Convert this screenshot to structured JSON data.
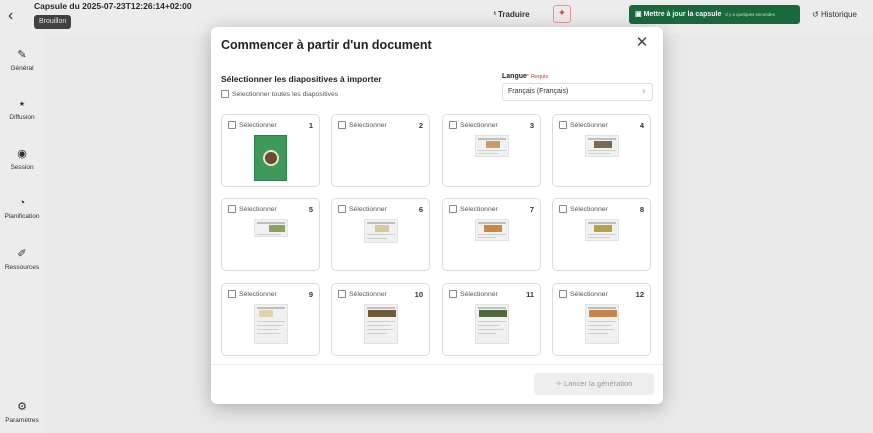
{
  "header": {
    "back_icon": "chevron-left-icon",
    "capsule_title": "Capsule du 2025-07-23T12:26:14+02:00",
    "status_badge": "Brouillon",
    "translate_label": "Traduire",
    "update_label": "Mettre à jour la capsule",
    "update_sub": "Il y a quelques secondes",
    "history_label": "Historique"
  },
  "sidebar": {
    "items": [
      {
        "label": "Général",
        "icon": "brush-icon"
      },
      {
        "label": "Diffusion",
        "icon": "share-icon"
      },
      {
        "label": "Session",
        "icon": "radio-icon"
      },
      {
        "label": "Planification",
        "icon": "timer-icon"
      },
      {
        "label": "Ressources",
        "icon": "paperclip-icon"
      }
    ],
    "settings_label": "Paramètres"
  },
  "modal": {
    "title": "Commencer à partir d'un document",
    "section_title": "Sélectionner les diapositives à importer",
    "select_all_label": "Sélectionner toutes les diapositives",
    "language_label": "Langue",
    "language_required_mark": "*",
    "language_required": "Requis",
    "language_value": "Français (Français)",
    "generate_label": "Lancer la génération",
    "slides": [
      {
        "label": "Sélectionner",
        "number": "1"
      },
      {
        "label": "Sélectionner",
        "number": "2"
      },
      {
        "label": "Sélectionner",
        "number": "3"
      },
      {
        "label": "Sélectionner",
        "number": "4"
      },
      {
        "label": "Sélectionner",
        "number": "5"
      },
      {
        "label": "Sélectionner",
        "number": "6"
      },
      {
        "label": "Sélectionner",
        "number": "7"
      },
      {
        "label": "Sélectionner",
        "number": "8"
      },
      {
        "label": "Sélectionner",
        "number": "9"
      },
      {
        "label": "Sélectionner",
        "number": "10"
      },
      {
        "label": "Sélectionner",
        "number": "11"
      },
      {
        "label": "Sélectionner",
        "number": "12"
      }
    ]
  },
  "colors": {
    "primary_green": "#1b6e3f",
    "required_red": "#c0392b",
    "cover_green": "#3d9a5a"
  }
}
